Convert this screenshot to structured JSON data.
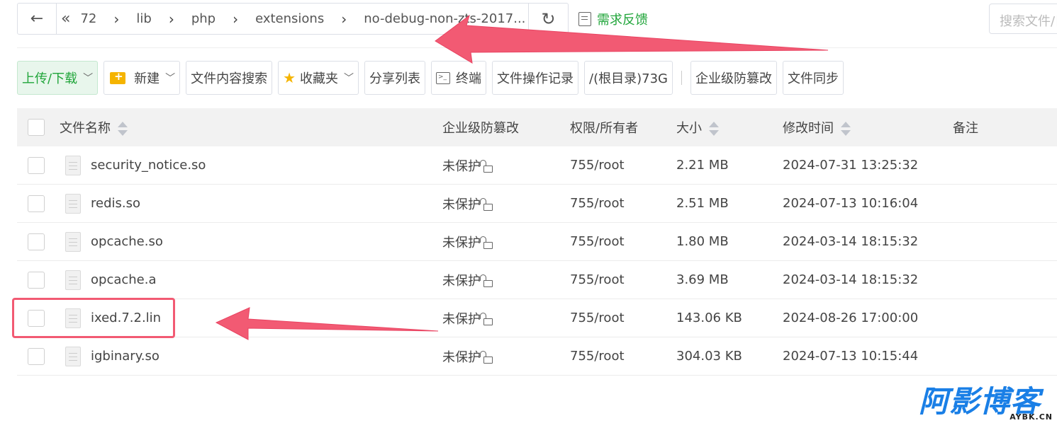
{
  "address_bar": {
    "back_icon": "←",
    "collapse_icon": "«",
    "segments": [
      "72",
      "lib",
      "php",
      "extensions",
      "no-debug-non-zts-2017..."
    ],
    "separator": "›",
    "refresh_icon": "↻"
  },
  "feedback": {
    "label": "需求反馈"
  },
  "search": {
    "placeholder": "搜索文件/目录"
  },
  "toolbar": {
    "upload_download": "上传/下载",
    "new": "新建",
    "content_search": "文件内容搜索",
    "favorites": "收藏夹",
    "share_list": "分享列表",
    "terminal": "终端",
    "op_log": "文件操作记录",
    "disk": "/(根目录)73G",
    "tamper_proof": "企业级防篡改",
    "file_sync": "文件同步"
  },
  "table": {
    "headers": {
      "name": "文件名称",
      "tamper": "企业级防篡改",
      "perm": "权限/所有者",
      "size": "大小",
      "mtime": "修改时间",
      "note": "备注"
    },
    "rows": [
      {
        "name": "security_notice.so",
        "protect": "未保护",
        "perm": "755/root",
        "size": "2.21 MB",
        "mtime": "2024-07-31 13:25:32"
      },
      {
        "name": "redis.so",
        "protect": "未保护",
        "perm": "755/root",
        "size": "2.51 MB",
        "mtime": "2024-07-13 10:16:04"
      },
      {
        "name": "opcache.so",
        "protect": "未保护",
        "perm": "755/root",
        "size": "1.80 MB",
        "mtime": "2024-03-14 18:15:32"
      },
      {
        "name": "opcache.a",
        "protect": "未保护",
        "perm": "755/root",
        "size": "3.69 MB",
        "mtime": "2024-03-14 18:15:32"
      },
      {
        "name": "ixed.7.2.lin",
        "protect": "未保护",
        "perm": "755/root",
        "size": "143.06 KB",
        "mtime": "2024-08-26 17:00:00"
      },
      {
        "name": "igbinary.so",
        "protect": "未保护",
        "perm": "755/root",
        "size": "304.03 KB",
        "mtime": "2024-07-13 10:15:44"
      }
    ]
  },
  "annotation_color": "#f25a73",
  "accent_color": "#20a53a",
  "watermark": {
    "main": "阿影博客",
    "sub": "AYBK.CN"
  }
}
